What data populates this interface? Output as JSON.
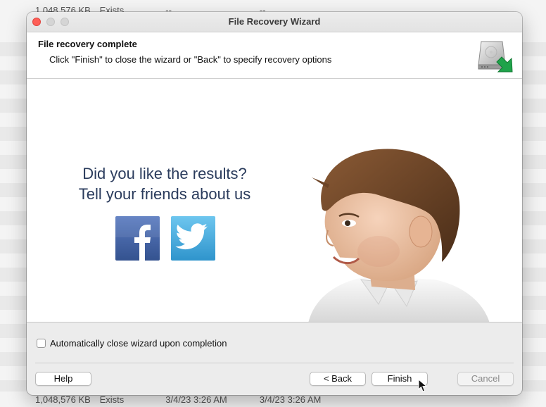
{
  "window": {
    "title": "File Recovery Wizard"
  },
  "header": {
    "title": "File recovery complete",
    "subtitle": "Click \"Finish\" to close the wizard or \"Back\" to specify recovery options"
  },
  "promo": {
    "line1": "Did you like the results?",
    "line2": "Tell your friends about us"
  },
  "options": {
    "auto_close_label": "Automatically close wizard upon completion",
    "auto_close_checked": false
  },
  "buttons": {
    "help": "Help",
    "back": "< Back",
    "finish": "Finish",
    "cancel": "Cancel"
  },
  "background_list": {
    "top_row": {
      "size": "1,048,576 KB",
      "status": "Exists",
      "created": "--",
      "modified": "--"
    },
    "bottom_row": {
      "size": "1,048,576 KB",
      "status": "Exists",
      "created": "3/4/23 3:26 AM",
      "modified": "3/4/23 3:26 AM"
    }
  },
  "colors": {
    "close_light": "#fe5f57",
    "facebook": "#3b5998",
    "twitter": "#3aa1db",
    "drive_arrow": "#1fa34a"
  }
}
